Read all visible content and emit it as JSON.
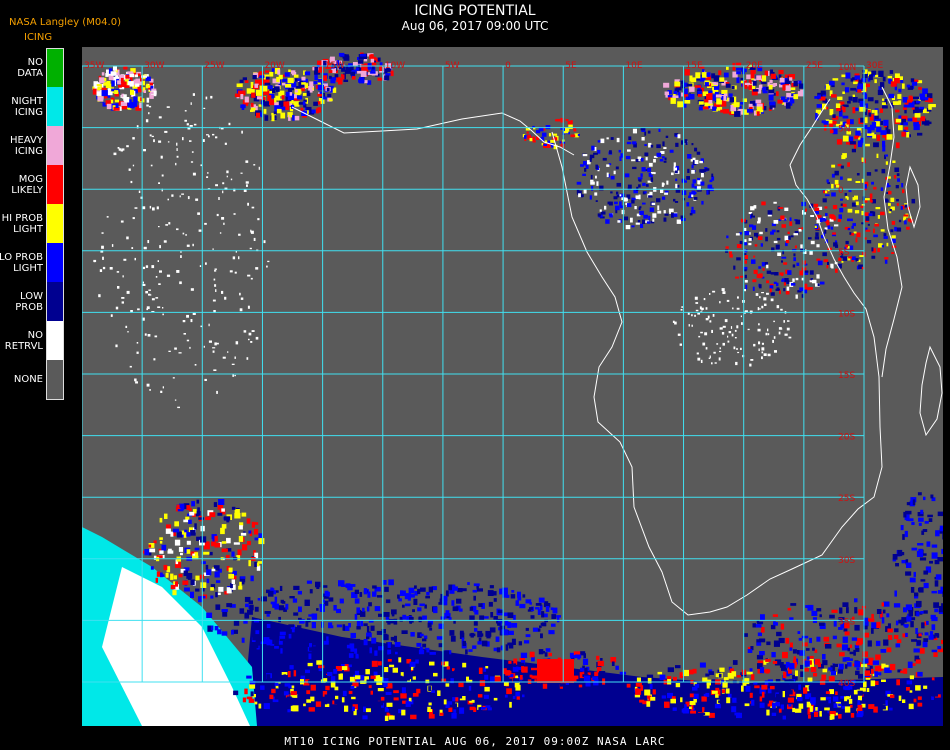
{
  "header": {
    "title": "ICING POTENTIAL",
    "date": "Aug 06, 2017 09:00 UTC"
  },
  "producer": {
    "name": "NASA Langley (M04.0)",
    "product": "ICING"
  },
  "legend": {
    "items": [
      {
        "label": "NO DATA",
        "color": "#00b000"
      },
      {
        "label": "NIGHT ICING",
        "color": "#00e8e8"
      },
      {
        "label": "HEAVY ICING",
        "color": "#f0a8d8"
      },
      {
        "label": "MOG LIKELY",
        "color": "#ff0000"
      },
      {
        "label": "HI PROB LIGHT",
        "color": "#ffff00"
      },
      {
        "label": "LO PROB LIGHT",
        "color": "#0000ff"
      },
      {
        "label": "LOW PROB",
        "color": "#000090"
      },
      {
        "label": "NO RETRVL",
        "color": "#ffffff"
      },
      {
        "label": "NONE",
        "color": "#5a5a5a"
      }
    ]
  },
  "map": {
    "background_color": "#5a5a5a",
    "grid_color": "#40e0f0",
    "coast_color": "#ffffff",
    "label_color": "#d01010",
    "top_labels": [
      "35W",
      "30W",
      "25W",
      "20W",
      "15W",
      "10W",
      "5W",
      "0",
      "5E",
      "10E",
      "15E",
      "20E",
      "25E",
      "30E"
    ],
    "right_labels": [
      "10N",
      "5N",
      "0",
      "5S",
      "10S",
      "15S",
      "20S",
      "25S",
      "30S",
      "35S",
      "40S"
    ]
  },
  "footer": {
    "text": "MT10  ICING POTENTIAL   AUG 06, 2017 09:00Z   NASA LARC"
  }
}
